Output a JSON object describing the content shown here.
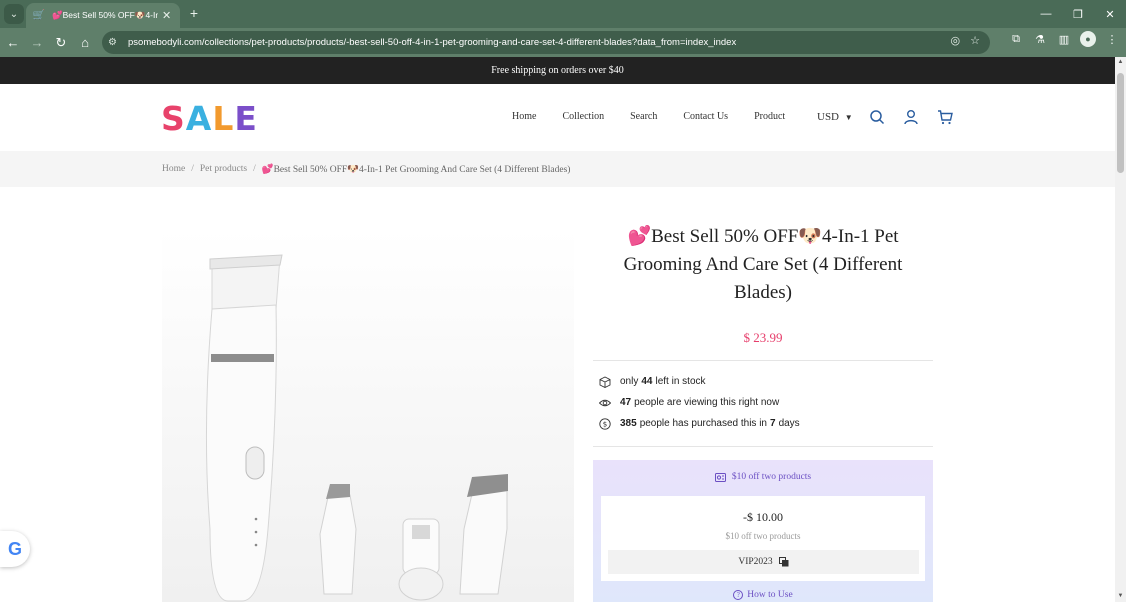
{
  "browser": {
    "tab_title": "💕Best Sell 50% OFF🐶4-In-1",
    "url": "psomebodyli.com/collections/pet-products/products/-best-sell-50-off-4-in-1-pet-grooming-and-care-set-4-different-blades?data_from=index_index"
  },
  "announcement": "Free shipping on orders over $40",
  "header": {
    "logo": [
      "S",
      "A",
      "L",
      "E"
    ],
    "nav": [
      "Home",
      "Collection",
      "Search",
      "Contact Us",
      "Product"
    ],
    "currency": "USD"
  },
  "breadcrumb": {
    "home": "Home",
    "category": "Pet products",
    "current": "💕Best Sell 50% OFF🐶4-In-1 Pet Grooming And Care Set (4 Different Blades)"
  },
  "product": {
    "title": "💕Best Sell 50% OFF🐶4-In-1 Pet Grooming And Care Set (4 Different Blades)",
    "price": "$ 23.99",
    "stock": {
      "prefix": "only",
      "count": "44",
      "suffix": "left in stock"
    },
    "viewing": {
      "count": "47",
      "suffix": "people are viewing this right now"
    },
    "purchased": {
      "count": "385",
      "middle": "people has purchased this in",
      "days": "7",
      "suffix": "days"
    }
  },
  "coupon": {
    "title": "$10 off two products",
    "amount": "-$ 10.00",
    "description": "$10 off two products",
    "code": "VIP2023",
    "how_to": "How to Use"
  },
  "colors": {
    "accent": "#e63e6b",
    "coupon_purple": "#6b4fc3",
    "chrome_green": "#5f7f6a"
  }
}
